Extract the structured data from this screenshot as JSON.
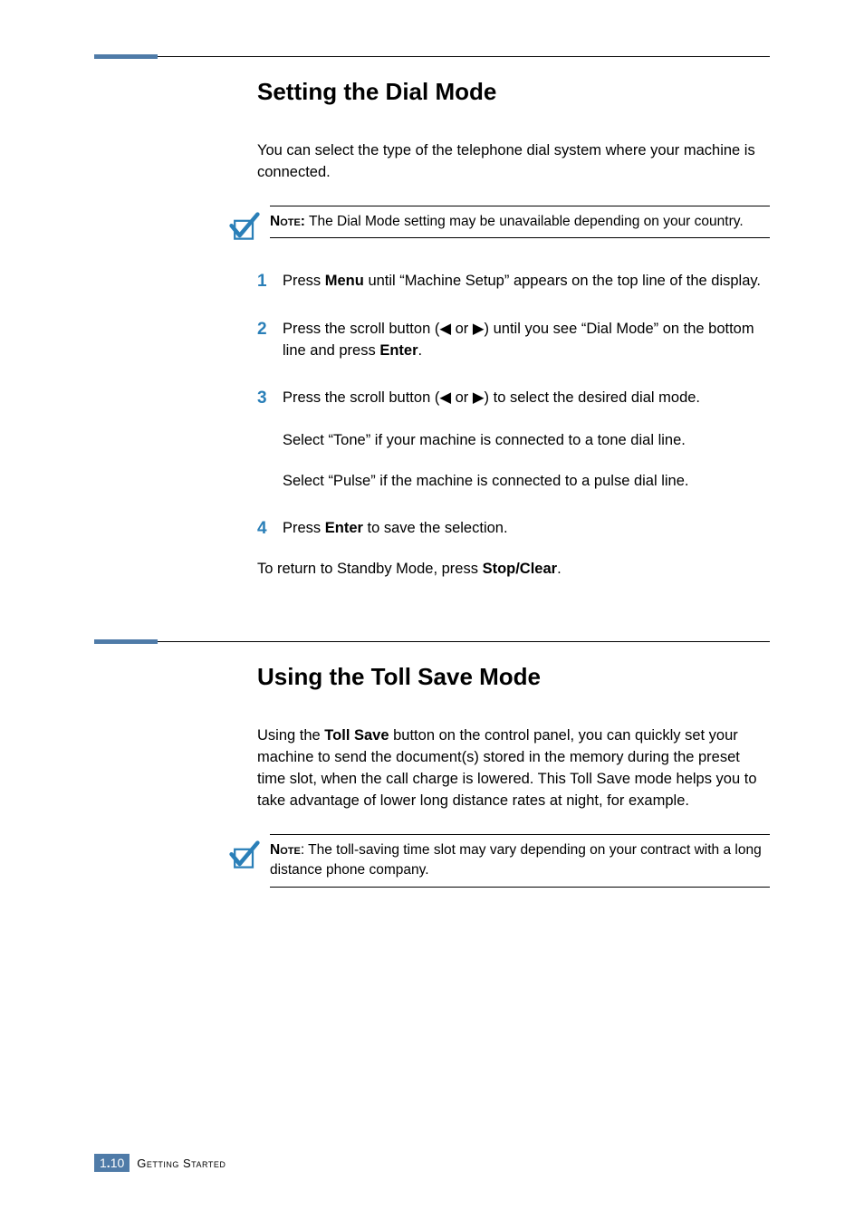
{
  "section1": {
    "heading": "Setting the Dial Mode",
    "intro": "You can select the type of the telephone dial system where your machine is connected.",
    "note_label": "Note:",
    "note_text": " The Dial Mode setting may be unavailable depending on your country.",
    "steps": {
      "s1_num": "1",
      "s1_a": "Press ",
      "s1_b": "Menu",
      "s1_c": " until “Machine Setup” appears on the top line of the display.",
      "s2_num": "2",
      "s2_a": "Press the scroll button (◀ or ▶) until you see “Dial Mode” on the bottom line and press ",
      "s2_b": "Enter",
      "s2_c": ".",
      "s3_num": "3",
      "s3_a": "Press the scroll button (◀ or ▶) to select the desired dial mode.",
      "s3_sub1": "Select “Tone” if your machine is connected to a tone dial line.",
      "s3_sub2": "Select “Pulse” if the machine is connected to a pulse dial line.",
      "s4_num": "4",
      "s4_a": "Press ",
      "s4_b": "Enter",
      "s4_c": " to save the selection."
    },
    "closing_a": "To return to Standby Mode, press ",
    "closing_b": "Stop/Clear",
    "closing_c": "."
  },
  "section2": {
    "heading": "Using the Toll Save Mode",
    "intro_a": "Using the ",
    "intro_b": "Toll Save",
    "intro_c": " button on the control panel, you can quickly set your machine to send the document(s) stored in the memory during the preset time slot, when the call charge is lowered. This Toll Save mode helps you to take advantage of lower long distance rates at night, for example.",
    "note_label": "Note",
    "note_text": ": The toll-saving time slot may vary depending on your contract with a long distance phone company."
  },
  "footer": {
    "page_chapter": "1",
    "page_dot": ".",
    "page_num": "10",
    "label": "Getting Started"
  }
}
